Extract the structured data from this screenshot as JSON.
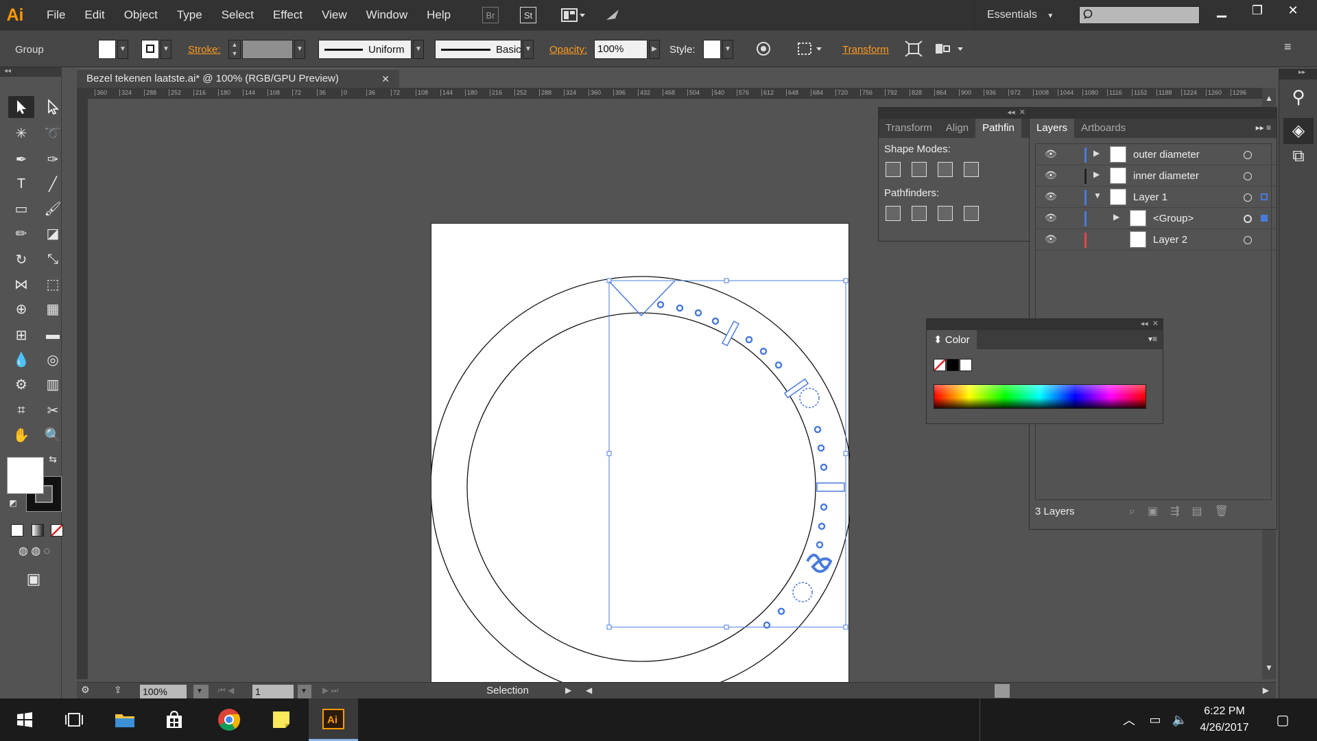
{
  "app": {
    "logo": "Ai",
    "menu": [
      "File",
      "Edit",
      "Object",
      "Type",
      "Select",
      "Effect",
      "View",
      "Window",
      "Help"
    ],
    "bridge_label": "Br",
    "stock_label": "St",
    "workspace": "Essentials"
  },
  "control_bar": {
    "selection_type": "Group",
    "stroke_label": "Stroke:",
    "stroke_profile": "Uniform",
    "brush": "Basic",
    "opacity_label": "Opacity:",
    "opacity_value": "100%",
    "style_label": "Style:",
    "transform_label": "Transform"
  },
  "document": {
    "tab_title": "Bezel tekenen laatste.ai* @ 100% (RGB/GPU Preview)",
    "ruler_ticks": [
      "360",
      "324",
      "288",
      "252",
      "216",
      "180",
      "144",
      "108",
      "72",
      "36",
      "0",
      "36",
      "72",
      "108",
      "144",
      "180",
      "216",
      "252",
      "288",
      "324",
      "360",
      "396",
      "432",
      "468",
      "504",
      "540",
      "576",
      "612",
      "648",
      "684",
      "720",
      "756",
      "792",
      "828",
      "864",
      "900",
      "936",
      "972",
      "1008",
      "1044",
      "1080",
      "1116",
      "1152",
      "1188",
      "1224",
      "1260",
      "1296"
    ]
  },
  "status_bar": {
    "zoom": "100%",
    "artboard_number": "1",
    "tool_status": "Selection"
  },
  "pathfinder_panel": {
    "tabs": [
      "Transform",
      "Align",
      "Pathfin"
    ],
    "active_tab": "Pathfin",
    "shape_modes_label": "Shape Modes:",
    "pathfinders_label": "Pathfinders:"
  },
  "layers_panel": {
    "tabs": [
      "Layers",
      "Artboards"
    ],
    "active_tab": "Layers",
    "rows": [
      {
        "name": "outer diameter",
        "color": "#4a7bdc",
        "expanded": false
      },
      {
        "name": "inner diameter",
        "color": "#222222",
        "expanded": false
      },
      {
        "name": "Layer 1",
        "color": "#4a7bdc",
        "expanded": true
      },
      {
        "name": "<Group>",
        "color": "#4a7bdc",
        "expanded": false
      },
      {
        "name": "Layer 2",
        "color": "#e04848",
        "expanded": false
      }
    ],
    "footer_count": "3 Layers"
  },
  "color_panel": {
    "title": "Color"
  },
  "taskbar": {
    "time": "6:22 PM",
    "date": "4/26/2017",
    "apps": [
      "start-icon",
      "task-view-icon",
      "file-explorer-icon",
      "store-icon",
      "chrome-icon",
      "sticky-notes-icon",
      "illustrator-icon"
    ]
  },
  "colors": {
    "accent_orange": "#ff9a00",
    "selection_blue": "#4a7bdc",
    "panel_bg": "#535353"
  }
}
